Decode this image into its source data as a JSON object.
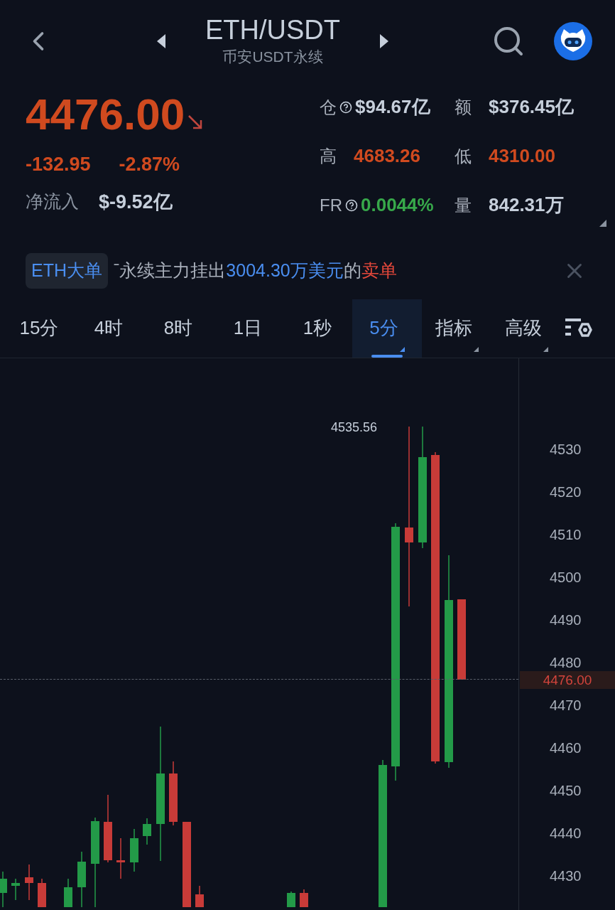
{
  "header": {
    "title": "ETH/USDT",
    "subtitle": "币安USDT永续"
  },
  "price": {
    "value": "4476.00",
    "change": "-132.95",
    "change_pct": "-2.87%",
    "net_flow_label": "净流入",
    "net_flow_value": "$-9.52亿"
  },
  "stats": [
    {
      "label": "仓",
      "help": true,
      "value": "$94.67亿",
      "kind": "neutral"
    },
    {
      "label": "额",
      "help": false,
      "value": "$376.45亿",
      "kind": "neutral"
    },
    {
      "label": "高",
      "help": false,
      "value": "4683.26",
      "kind": "down"
    },
    {
      "label": "低",
      "help": false,
      "value": "4310.00",
      "kind": "down"
    },
    {
      "label": "FR",
      "help": true,
      "value": "0.0044%",
      "kind": "up"
    },
    {
      "label": "量",
      "help": false,
      "value": "842.31万",
      "kind": "neutral"
    }
  ],
  "notice": {
    "tag": "ETH大单",
    "parts": [
      {
        "text": "ˉ永续主力挂出",
        "kind": "plain"
      },
      {
        "text": "3004.30万美元",
        "kind": "highlight"
      },
      {
        "text": "的",
        "kind": "plain"
      },
      {
        "text": "卖单",
        "kind": "sell"
      }
    ]
  },
  "tabs": [
    {
      "label": "15分",
      "selected": false,
      "dropdown": false
    },
    {
      "label": "4时",
      "selected": false,
      "dropdown": false
    },
    {
      "label": "8时",
      "selected": false,
      "dropdown": false
    },
    {
      "label": "1日",
      "selected": false,
      "dropdown": false
    },
    {
      "label": "1秒",
      "selected": false,
      "dropdown": false
    },
    {
      "label": "5分",
      "selected": true,
      "dropdown": true
    },
    {
      "label": "指标",
      "selected": false,
      "dropdown": true
    },
    {
      "label": "高级",
      "selected": false,
      "dropdown": true
    }
  ],
  "chart": {
    "high_label": "4535.56",
    "current_price": "4476.00",
    "axis_labels": [
      "4530",
      "4520",
      "4510",
      "4500",
      "4490",
      "4480",
      "4470",
      "4460",
      "4450",
      "4440",
      "4430"
    ]
  }
}
